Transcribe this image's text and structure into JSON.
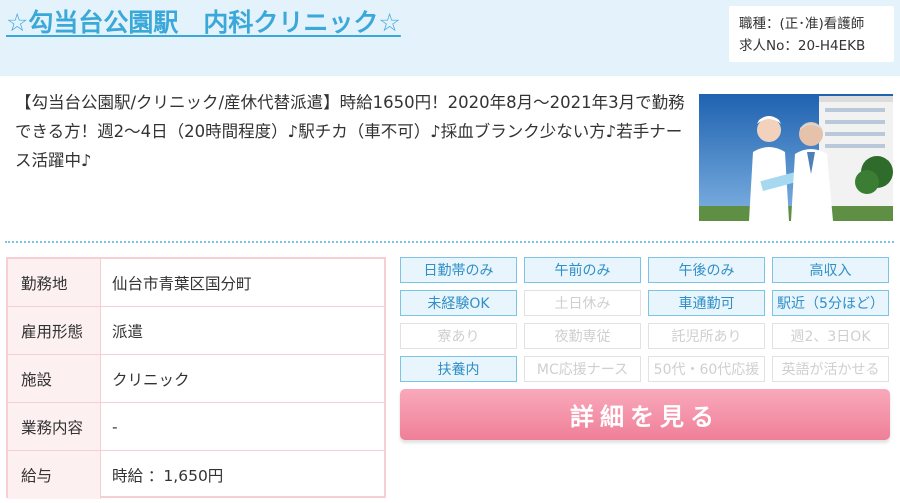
{
  "header": {
    "title": "☆勾当台公園駅　内科クリニック☆",
    "job_type": "職種：(正･准)看護師",
    "job_id": "求人No：20-H4EKB"
  },
  "description": "【勾当台公園駅/クリニック/産休代替派遣】時給1650円！2020年8月～2021年3月で勤務できる方！週2～4日（20時間程度）♪駅チカ（車不可）♪採血ブランク少ない方♪若手ナース活躍中♪",
  "details": [
    {
      "label": "勤務地",
      "value": "仙台市青葉区国分町"
    },
    {
      "label": "雇用形態",
      "value": "派遣"
    },
    {
      "label": "施設",
      "value": "クリニック"
    },
    {
      "label": "業務内容",
      "value": "-"
    },
    {
      "label": "給与",
      "value": "時給 ：1,650円"
    }
  ],
  "tags": [
    {
      "label": "日勤帯のみ",
      "active": true
    },
    {
      "label": "午前のみ",
      "active": true
    },
    {
      "label": "午後のみ",
      "active": true
    },
    {
      "label": "高収入",
      "active": true
    },
    {
      "label": "未経験OK",
      "active": true
    },
    {
      "label": "土日休み",
      "active": false
    },
    {
      "label": "車通勤可",
      "active": true
    },
    {
      "label": "駅近（5分ほど）",
      "active": true
    },
    {
      "label": "寮あり",
      "active": false
    },
    {
      "label": "夜勤専従",
      "active": false
    },
    {
      "label": "託児所あり",
      "active": false
    },
    {
      "label": "週2、3日OK",
      "active": false
    },
    {
      "label": "扶養内",
      "active": true
    },
    {
      "label": "MC応援ナース",
      "active": false
    },
    {
      "label": "50代・60代応援",
      "active": false
    },
    {
      "label": "英語が活かせる",
      "active": false
    }
  ],
  "detail_button": "詳細を見る",
  "colors": {
    "accent": "#3aa8d8",
    "header_bg": "#e4f2fb",
    "tag_active_bg": "#e8f5fc",
    "tag_border": "#7cc4e4",
    "table_border": "#f6cfd4",
    "button": "#ef7f99"
  }
}
